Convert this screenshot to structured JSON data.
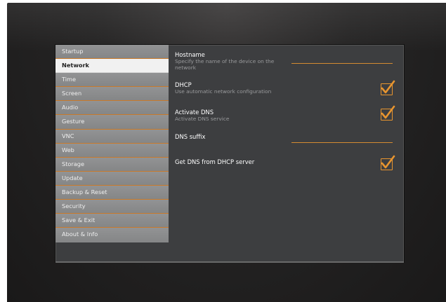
{
  "sidebar": {
    "items": [
      {
        "label": "Startup",
        "active": false
      },
      {
        "label": "Network",
        "active": true
      },
      {
        "label": "Time",
        "active": false
      },
      {
        "label": "Screen",
        "active": false
      },
      {
        "label": "Audio",
        "active": false
      },
      {
        "label": "Gesture",
        "active": false
      },
      {
        "label": "VNC",
        "active": false
      },
      {
        "label": "Web",
        "active": false
      },
      {
        "label": "Storage",
        "active": false
      },
      {
        "label": "Update",
        "active": false
      },
      {
        "label": "Backup & Reset",
        "active": false
      },
      {
        "label": "Security",
        "active": false
      },
      {
        "label": "Save & Exit",
        "active": false
      },
      {
        "label": "About & Info",
        "active": false
      }
    ]
  },
  "network": {
    "hostname": {
      "title": "Hostname",
      "description": "Specify the name of the device on the network",
      "value": ""
    },
    "dhcp": {
      "title": "DHCP",
      "description": "Use automatic network configuration",
      "checked": true
    },
    "activate_dns": {
      "title": "Activate DNS",
      "description": "Activate DNS service",
      "checked": true
    },
    "dns_suffix": {
      "title": "DNS suffix",
      "value": ""
    },
    "dns_from_dhcp": {
      "title": "Get DNS from DHCP server",
      "checked": true
    }
  },
  "colors": {
    "accent": "#e8952f",
    "screen_bg": "#3d3e40",
    "sidebar_bg": "#8a8b8c",
    "active_item_bg": "#f1f1f1"
  },
  "icons": {
    "checkbox": "checkmark-icon"
  }
}
